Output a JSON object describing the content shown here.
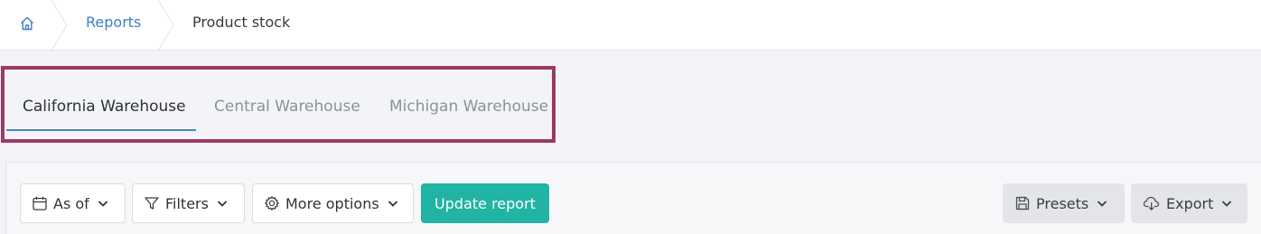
{
  "breadcrumb": {
    "home_icon": "home-icon",
    "items": [
      {
        "label": "Reports"
      },
      {
        "label": "Product stock"
      }
    ]
  },
  "tabs": [
    {
      "label": "California Warehouse",
      "active": true
    },
    {
      "label": "Central Warehouse",
      "active": false
    },
    {
      "label": "Michigan Warehouse",
      "active": false
    }
  ],
  "toolbar": {
    "as_of": {
      "label": "As of",
      "icon": "calendar-icon"
    },
    "filters": {
      "label": "Filters",
      "icon": "filter-icon"
    },
    "more_options": {
      "label": "More options",
      "icon": "gear-icon"
    },
    "update": {
      "label": "Update report"
    },
    "presets": {
      "label": "Presets",
      "icon": "save-icon"
    },
    "export": {
      "label": "Export",
      "icon": "cloud-download-icon"
    }
  },
  "colors": {
    "accent_link": "#3d7fc4",
    "tab_underline": "#4a85c8",
    "highlight_frame": "#9c3a63",
    "primary_button": "#21b3a3"
  }
}
